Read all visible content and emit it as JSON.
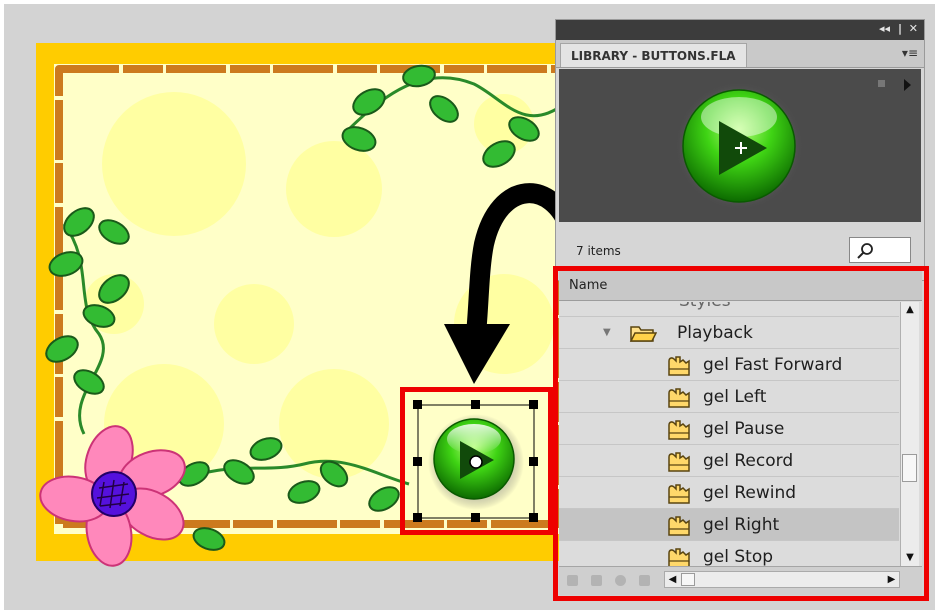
{
  "library": {
    "title": "LIBRARY - BUTTONS.FLA",
    "controls": {
      "collapse": "◂◂",
      "separator": "|",
      "close": "✕"
    },
    "panel_menu": "▾≡",
    "items_count": "7 items",
    "column_name": "Name"
  },
  "tree": {
    "parent_folder": "Styles",
    "folder": "Playback",
    "items": [
      "gel Fast Forward",
      "gel Left",
      "gel Pause",
      "gel Record",
      "gel Rewind",
      "gel Right",
      "gel Stop"
    ],
    "selected": "gel Right"
  },
  "icons": {
    "search": "magnifier-icon",
    "folder": "folder-open-icon",
    "symbol": "button-symbol-icon",
    "play": "play-icon",
    "arrow": "curved-arrow-icon"
  },
  "colors": {
    "highlight": "#ee0000",
    "stage_frame": "#ffcc00",
    "canvas": "#ffffcc",
    "gel_green": "#33cc00",
    "flower_pink": "#ff88bb",
    "flower_center": "#5511dd"
  }
}
